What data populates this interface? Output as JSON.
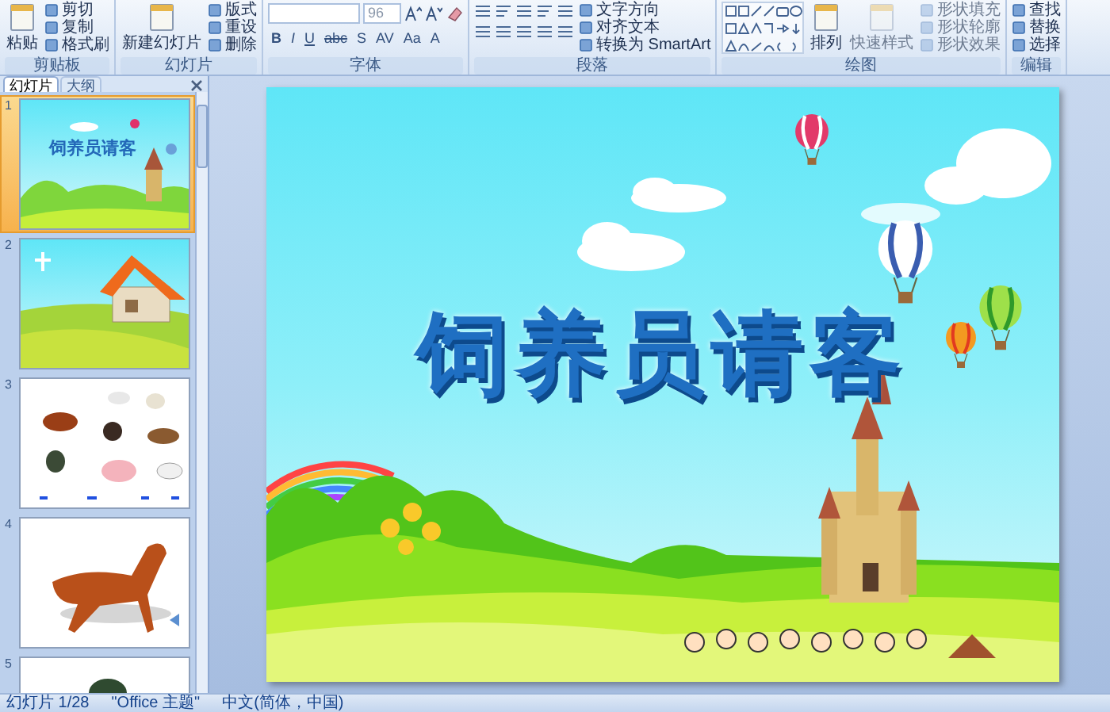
{
  "ribbon": {
    "groups": [
      {
        "label": "剪贴板",
        "items": [
          {
            "kind": "large",
            "label": "粘贴",
            "disabled": false
          },
          {
            "kind": "small",
            "label": "剪切",
            "disabled": false
          },
          {
            "kind": "small",
            "label": "复制",
            "disabled": false
          },
          {
            "kind": "small",
            "label": "格式刷",
            "disabled": false
          }
        ]
      },
      {
        "label": "幻灯片",
        "items": [
          {
            "kind": "large",
            "label": "新建幻灯片",
            "disabled": false
          },
          {
            "kind": "small",
            "label": "版式",
            "disabled": false
          },
          {
            "kind": "small",
            "label": "重设",
            "disabled": false
          },
          {
            "kind": "small",
            "label": "删除",
            "disabled": false
          }
        ]
      },
      {
        "label": "字体",
        "font": {
          "size": "96",
          "buttons": [
            "B",
            "I",
            "U",
            "abc",
            "S",
            "AV",
            "Aa",
            "A"
          ]
        }
      },
      {
        "label": "段落",
        "items": [
          {
            "kind": "paragraph"
          },
          {
            "kind": "small",
            "label": "文字方向",
            "disabled": false
          },
          {
            "kind": "small",
            "label": "对齐文本",
            "disabled": false
          },
          {
            "kind": "small",
            "label": "转换为 SmartArt",
            "disabled": false
          }
        ]
      },
      {
        "label": "绘图",
        "items": [
          {
            "kind": "shapes"
          },
          {
            "kind": "large",
            "label": "排列",
            "disabled": false
          },
          {
            "kind": "large",
            "label": "快速样式",
            "disabled": true
          },
          {
            "kind": "small",
            "label": "形状填充",
            "disabled": true
          },
          {
            "kind": "small",
            "label": "形状轮廓",
            "disabled": true
          },
          {
            "kind": "small",
            "label": "形状效果",
            "disabled": true
          }
        ]
      },
      {
        "label": "编辑",
        "items": [
          {
            "kind": "small",
            "label": "查找",
            "disabled": false
          },
          {
            "kind": "small",
            "label": "替换",
            "disabled": false
          },
          {
            "kind": "small",
            "label": "选择",
            "disabled": false
          }
        ]
      }
    ]
  },
  "panel": {
    "tabs": [
      {
        "label": "幻灯片",
        "selected": true
      },
      {
        "label": "大纲",
        "selected": false
      }
    ],
    "thumbnails": [
      {
        "number": "1",
        "kind": "title",
        "title": "饲养员请客",
        "selected": true
      },
      {
        "number": "2",
        "kind": "house",
        "selected": false
      },
      {
        "number": "3",
        "kind": "animals",
        "selected": false
      },
      {
        "number": "4",
        "kind": "horse",
        "selected": false
      },
      {
        "number": "5",
        "kind": "duck",
        "selected": false
      }
    ]
  },
  "slide": {
    "title": "饲养员请客"
  },
  "status_bar": [
    "幻灯片 1/28",
    "\"Office 主题\"",
    "中文(简体，中国)"
  ]
}
